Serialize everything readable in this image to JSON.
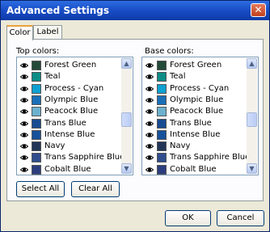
{
  "window": {
    "title": "Advanced Settings",
    "close_label": "✕"
  },
  "tabs": [
    {
      "label": "Color",
      "active": true
    },
    {
      "label": "Label",
      "active": false
    }
  ],
  "top_colors": {
    "title": "Top colors:",
    "items": [
      {
        "label": "Forest Green",
        "color": "#244a39"
      },
      {
        "label": "Teal",
        "color": "#0d8d86"
      },
      {
        "label": "Process - Cyan",
        "color": "#0fa1d2"
      },
      {
        "label": "Olympic Blue",
        "color": "#1b6fb7"
      },
      {
        "label": "Peacock Blue",
        "color": "#6cb1cf"
      },
      {
        "label": "Trans Blue",
        "color": "#174c92"
      },
      {
        "label": "Intense Blue",
        "color": "#16519c"
      },
      {
        "label": "Navy",
        "color": "#223557"
      },
      {
        "label": "Trans Sapphire Blue",
        "color": "#304d8d"
      },
      {
        "label": "Cobalt Blue",
        "color": "#2c3d7e"
      }
    ]
  },
  "base_colors": {
    "title": "Base colors:",
    "items": [
      {
        "label": "Forest Green",
        "color": "#244a39"
      },
      {
        "label": "Teal",
        "color": "#0d8d86"
      },
      {
        "label": "Process - Cyan",
        "color": "#0fa1d2"
      },
      {
        "label": "Olympic Blue",
        "color": "#1b6fb7"
      },
      {
        "label": "Peacock Blue",
        "color": "#6cb1cf"
      },
      {
        "label": "Trans Blue",
        "color": "#174c92"
      },
      {
        "label": "Intense Blue",
        "color": "#16519c"
      },
      {
        "label": "Navy",
        "color": "#223557"
      },
      {
        "label": "Trans Sapphire Blue",
        "color": "#304d8d"
      },
      {
        "label": "Cobalt Blue",
        "color": "#2c3d7e"
      }
    ]
  },
  "buttons": {
    "select_all": "Select All",
    "clear_all": "Clear All",
    "ok": "OK",
    "cancel": "Cancel"
  }
}
